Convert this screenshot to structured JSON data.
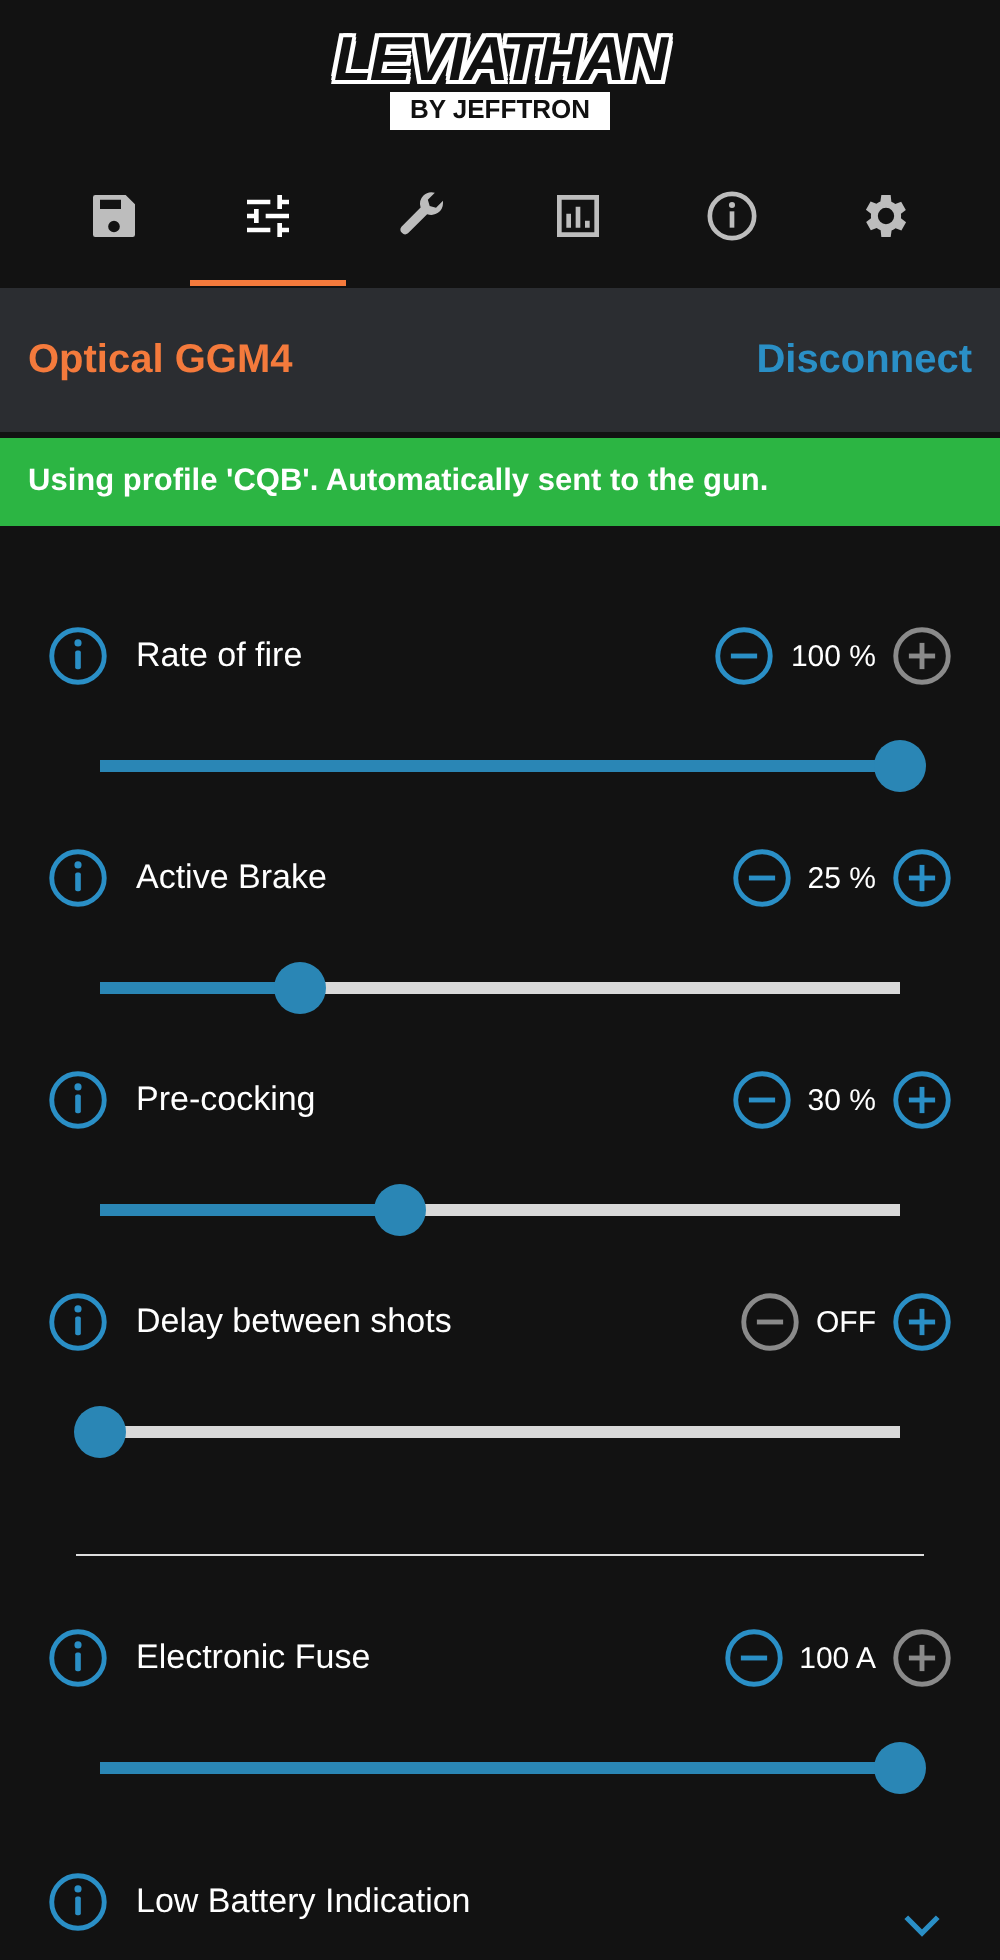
{
  "logo": {
    "title": "LEVIATHAN",
    "subtitle": "BY JEFFTRON"
  },
  "tabs": [
    {
      "selected": false
    },
    {
      "selected": true
    },
    {
      "selected": false
    },
    {
      "selected": false
    },
    {
      "selected": false
    },
    {
      "selected": false
    }
  ],
  "device": {
    "name": "Optical GGM4",
    "action": "Disconnect"
  },
  "banner": "Using profile 'CQB'. Automatically sent to the gun.",
  "groups": [
    [
      {
        "kind": "slider",
        "label": "Rate of fire",
        "value": "100 %",
        "level": 1,
        "minus_disabled": false,
        "plus_disabled": true
      },
      {
        "kind": "slider",
        "label": "Active Brake",
        "value": "25 %",
        "level": 0.25,
        "minus_disabled": false,
        "plus_disabled": false
      },
      {
        "kind": "slider",
        "label": "Pre-cocking",
        "value": "30 %",
        "level": 0.375,
        "minus_disabled": false,
        "plus_disabled": false
      },
      {
        "kind": "slider",
        "label": "Delay between shots",
        "value": "OFF",
        "level": 0,
        "minus_disabled": true,
        "plus_disabled": false
      }
    ],
    [
      {
        "kind": "slider",
        "label": "Electronic Fuse",
        "value": "100 A",
        "level": 1,
        "minus_disabled": false,
        "plus_disabled": true
      },
      {
        "kind": "dropdown",
        "label": "Low Battery Indication",
        "expanded": false
      }
    ]
  ]
}
